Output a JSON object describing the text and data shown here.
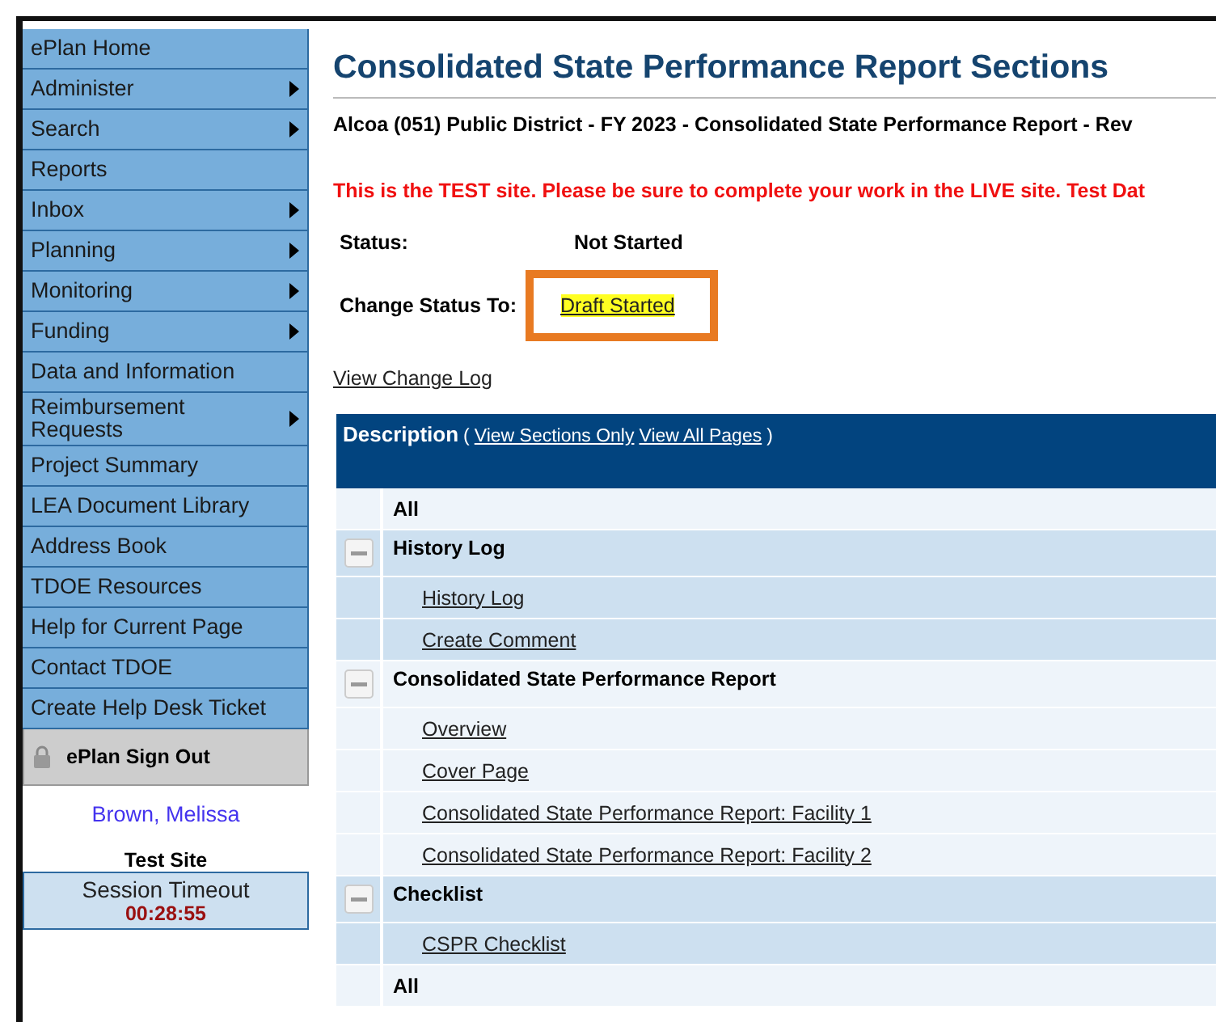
{
  "sidebar": {
    "items": [
      {
        "label": "ePlan Home",
        "submenu": false
      },
      {
        "label": "Administer",
        "submenu": true
      },
      {
        "label": "Search",
        "submenu": true
      },
      {
        "label": "Reports",
        "submenu": false
      },
      {
        "label": "Inbox",
        "submenu": true
      },
      {
        "label": "Planning",
        "submenu": true
      },
      {
        "label": "Monitoring",
        "submenu": true
      },
      {
        "label": "Funding",
        "submenu": true
      },
      {
        "label": "Data and Information",
        "submenu": false
      },
      {
        "label": "Reimbursement Requests",
        "submenu": true
      },
      {
        "label": "Project Summary",
        "submenu": false
      },
      {
        "label": "LEA Document Library",
        "submenu": false
      },
      {
        "label": "Address Book",
        "submenu": false
      },
      {
        "label": "TDOE Resources",
        "submenu": false
      },
      {
        "label": "Help for Current Page",
        "submenu": false
      },
      {
        "label": "Contact TDOE",
        "submenu": false
      },
      {
        "label": "Create Help Desk Ticket",
        "submenu": false
      }
    ],
    "sign_out": "ePlan Sign Out",
    "user": "Brown, Melissa",
    "site": "Test Site",
    "session_label": "Session Timeout",
    "session_time": "00:28:55"
  },
  "main": {
    "title": "Consolidated State Performance Report Sections",
    "subtitle": "Alcoa (051) Public District - FY 2023 - Consolidated State Performance Report - Rev",
    "warning": "This is the TEST site. Please be sure to complete your work in the LIVE site. Test Dat",
    "status_label": "Status:",
    "status_value": "Not Started",
    "change_label": "Change Status To:",
    "change_link": "Draft Started",
    "change_log": "View Change Log",
    "table": {
      "header": "Description",
      "paren_open": "(",
      "links": [
        "View Sections Only",
        "View All Pages"
      ],
      "paren_close": ")",
      "all_top": "All",
      "groups": [
        {
          "title": "History Log",
          "expanded": true,
          "children": [
            "History Log",
            "Create Comment"
          ]
        },
        {
          "title": "Consolidated State Performance Report",
          "expanded": true,
          "children": [
            "Overview",
            "Cover Page",
            "Consolidated State Performance Report: Facility 1",
            "Consolidated State Performance Report: Facility 2"
          ]
        },
        {
          "title": "Checklist",
          "expanded": true,
          "children": [
            "CSPR Checklist"
          ]
        }
      ],
      "all_bottom": "All"
    }
  }
}
